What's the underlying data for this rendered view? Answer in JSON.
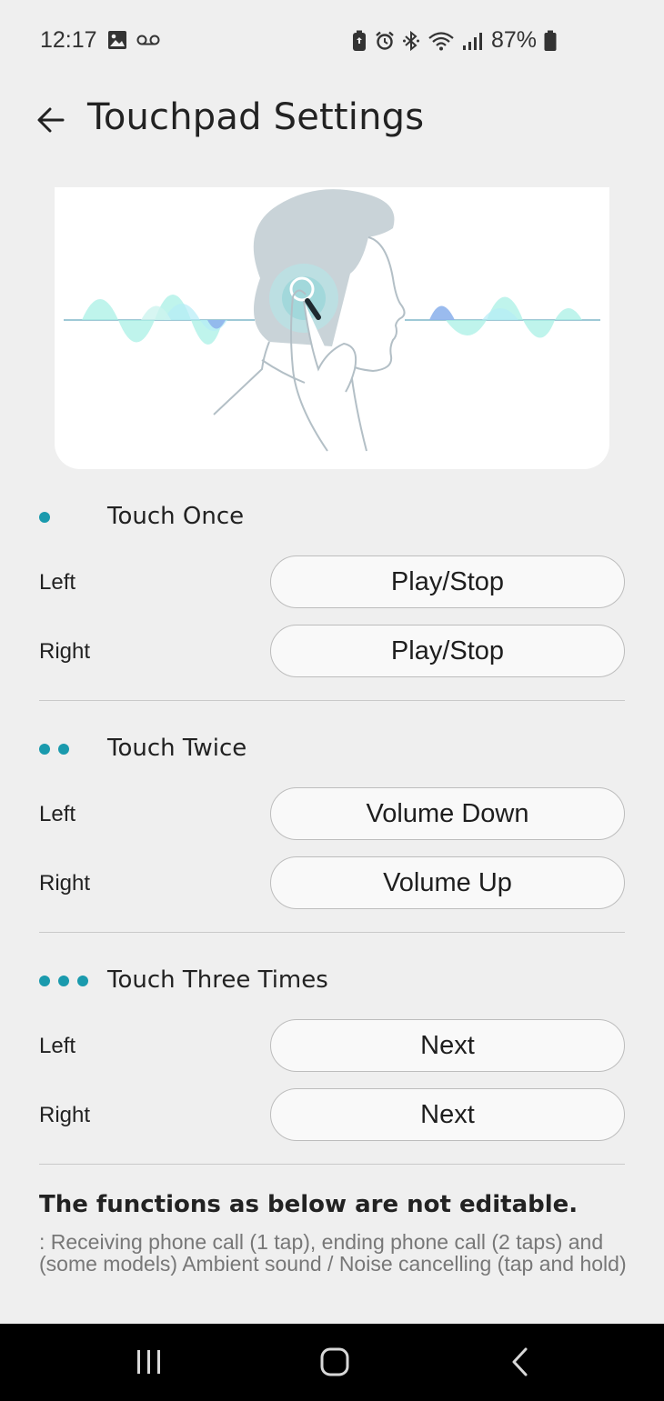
{
  "status_bar": {
    "time": "12:17",
    "battery_percent": "87%",
    "left_icons": [
      "gallery-icon",
      "voicemail-icon"
    ],
    "right_icons": [
      "battery-saver-icon",
      "alarm-icon",
      "bluetooth-icon",
      "wifi-icon",
      "signal-icon",
      "battery-icon"
    ]
  },
  "header": {
    "title": "Touchpad Settings",
    "back_icon": "arrow-left-icon"
  },
  "colors": {
    "accent": "#1a9aad",
    "background": "#efefef",
    "nav_bar": "#000000"
  },
  "sections": [
    {
      "title": "Touch Once",
      "dots": 1,
      "rows": [
        {
          "label": "Left",
          "value": "Play/Stop"
        },
        {
          "label": "Right",
          "value": "Play/Stop"
        }
      ]
    },
    {
      "title": "Touch Twice",
      "dots": 2,
      "rows": [
        {
          "label": "Left",
          "value": "Volume Down"
        },
        {
          "label": "Right",
          "value": "Volume Up"
        }
      ]
    },
    {
      "title": "Touch Three Times",
      "dots": 3,
      "rows": [
        {
          "label": "Left",
          "value": "Next"
        },
        {
          "label": "Right",
          "value": "Next"
        }
      ]
    }
  ],
  "note": {
    "title": "The functions as below are not editable.",
    "body": ": Receiving phone call (1 tap), ending phone call (2 taps) and (some models) Ambient sound / Noise cancelling (tap and hold)"
  },
  "nav_bar": {
    "icons": [
      "recent-apps-icon",
      "home-icon",
      "back-icon"
    ]
  }
}
